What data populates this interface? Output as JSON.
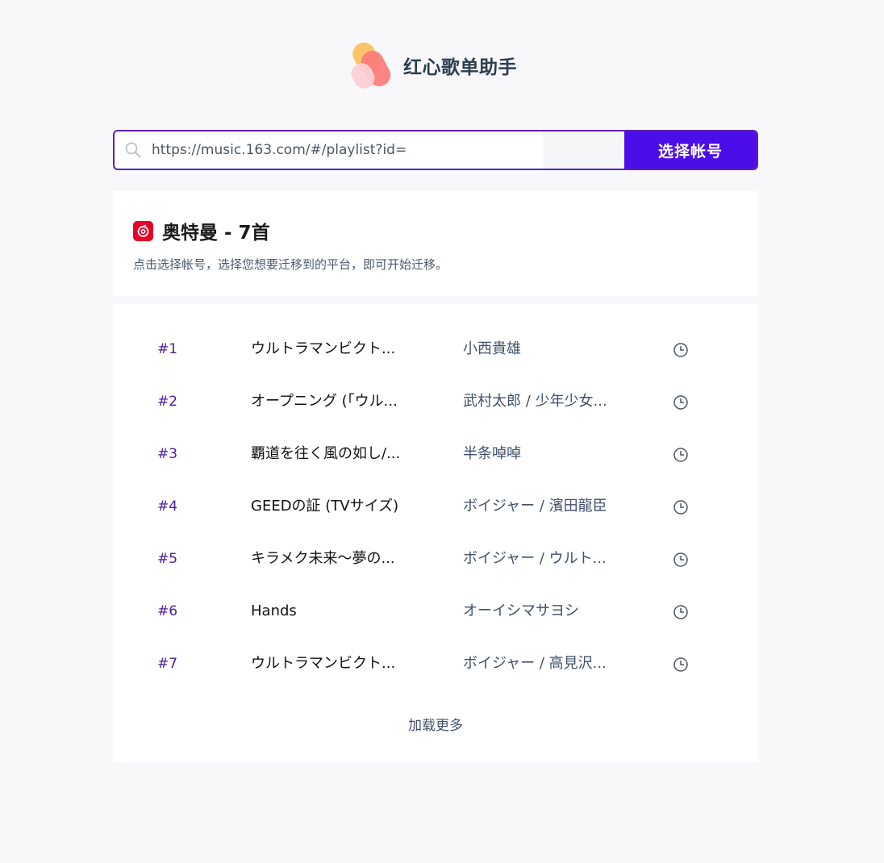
{
  "app": {
    "title": "红心歌单助手"
  },
  "search": {
    "value": "https://music.163.com/#/playlist?id=",
    "button_label": "选择帐号"
  },
  "playlist": {
    "title": "奥特曼 - 7首",
    "hint": "点击选择帐号，选择您想要迁移到的平台，即可开始迁移。",
    "platform_icon": "netease-music-icon"
  },
  "tracks": [
    {
      "num": "#1",
      "title": "ウルトラマンビクト...",
      "artist": "小西貴雄"
    },
    {
      "num": "#2",
      "title": "オープニング (「ウル...",
      "artist": "武村太郎 / 少年少女..."
    },
    {
      "num": "#3",
      "title": "覇道を往く風の如し/...",
      "artist": "半条啅啅"
    },
    {
      "num": "#4",
      "title": "GEEDの証 (TVサイズ)",
      "artist": "ボイジャー / 濱田龍臣"
    },
    {
      "num": "#5",
      "title": "キラメク未来～夢の...",
      "artist": "ボイジャー / ウルト..."
    },
    {
      "num": "#6",
      "title": "Hands",
      "artist": "オーイシマサヨシ"
    },
    {
      "num": "#7",
      "title": "ウルトラマンビクト...",
      "artist": "ボイジャー / 高見沢..."
    }
  ],
  "list": {
    "load_more": "加载更多"
  },
  "colors": {
    "accent": "#4c0ee8",
    "border": "#5b21b6",
    "netease_red": "#e60026"
  }
}
